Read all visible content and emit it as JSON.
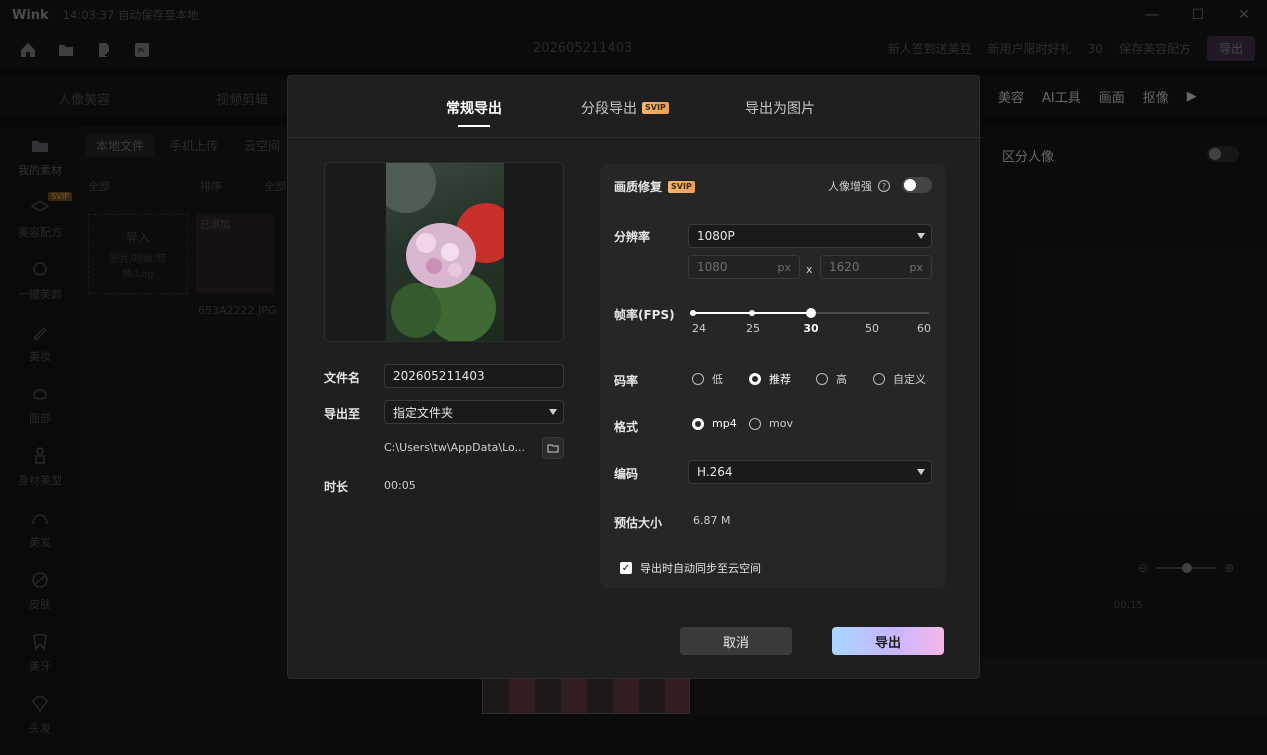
{
  "app": {
    "logo": "Wink",
    "save_status": "14:03:37 自动保存至本地",
    "project_title": "202605211403",
    "win_controls": [
      "—",
      "☐",
      "✕"
    ]
  },
  "top_right": {
    "checkin": "新人签到送美豆",
    "gift": "新用户限时好礼",
    "beans": "30",
    "save_recipe": "保存美容配方",
    "export": "导出"
  },
  "module_tabs": [
    "人像美容",
    "视频剪辑"
  ],
  "right_tabs": [
    "美容",
    "AI工具",
    "画面",
    "抠像"
  ],
  "right_panel": {
    "label": "区分人像"
  },
  "sidebar": {
    "items": [
      "我的素材",
      "美容配方",
      "一键美颜",
      "美妆",
      "面部",
      "身材美型",
      "美发",
      "皮肤",
      "美牙",
      "头发"
    ],
    "svip_badge": "SVIP"
  },
  "media": {
    "tabs": [
      "本地文件",
      "手机上传",
      "云空间"
    ],
    "filter_all": "全部",
    "sort": "排序",
    "filter_all2": "全部",
    "import": "导入",
    "import_hint": "图片/视频/音频/Log",
    "added_badge": "已添加",
    "file_name": "653A2222.JPG"
  },
  "timeline": {
    "time_mark": "00:15"
  },
  "modal": {
    "tabs": [
      {
        "label": "常规导出",
        "active": true
      },
      {
        "label": "分段导出",
        "badge": "SVIP"
      },
      {
        "label": "导出为图片"
      }
    ],
    "file_name_label": "文件名",
    "file_name_value": "202605211403",
    "export_to_label": "导出至",
    "export_to_value": "指定文件夹",
    "path": "C:\\Users\\tw\\AppData\\Lo...",
    "duration_label": "时长",
    "duration_value": "00:05",
    "quality_label": "画质修复",
    "quality_badge": "SVIP",
    "portrait_enhance_label": "人像增强",
    "resolution_label": "分辨率",
    "resolution_value": "1080P",
    "width": "1080",
    "height": "1620",
    "px": "px",
    "x_sep": "x",
    "fps_label": "帧率(FPS)",
    "fps_ticks": [
      "24",
      "25",
      "30",
      "50",
      "60"
    ],
    "fps_selected": "30",
    "bitrate_label": "码率",
    "bitrate_options": [
      "低",
      "推荐",
      "高",
      "自定义"
    ],
    "bitrate_selected": "推荐",
    "format_label": "格式",
    "format_options": [
      "mp4",
      "mov"
    ],
    "format_selected": "mp4",
    "codec_label": "编码",
    "codec_value": "H.264",
    "size_label": "预估大小",
    "size_value": "6.87 M",
    "sync_label": "导出时自动同步至云空间",
    "sync_checked": true,
    "cancel": "取消",
    "export": "导出"
  }
}
